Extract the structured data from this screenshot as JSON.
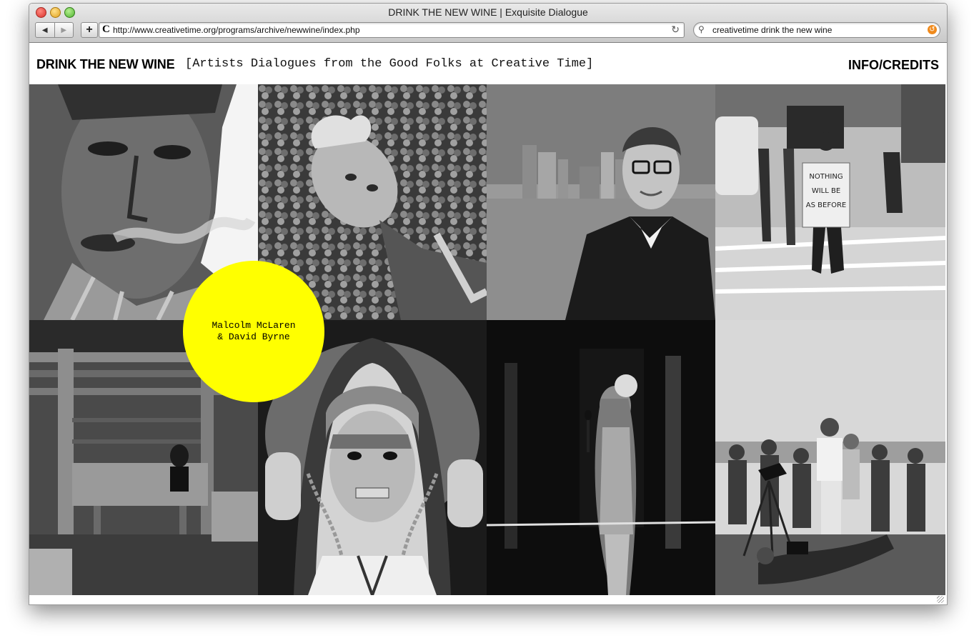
{
  "window": {
    "title": "DRINK THE NEW WINE | Exquisite Dialogue"
  },
  "toolbar": {
    "back_glyph": "◀",
    "forward_glyph": "▶",
    "add_glyph": "+",
    "url": "http://www.creativetime.org/programs/archive/newwine/index.php",
    "search_query": "creativetime drink the new wine",
    "favicon_glyph": "C"
  },
  "header": {
    "title": "DRINK THE NEW WINE",
    "subtitle": "[Artists Dialogues from the Good Folks at Creative Time]",
    "info_link": "INFO/CREDITS"
  },
  "hover_label": {
    "line1": "Malcolm McLaren",
    "line2": "& David Byrne"
  },
  "tiles": [
    {
      "icon": "portrait-smoking-man-photo"
    },
    {
      "icon": "man-lying-in-clover-photo"
    },
    {
      "icon": "man-glasses-waterfront-photo"
    },
    {
      "icon": "protester-sign-street-photo"
    },
    {
      "icon": "woman-in-wooden-barn-photo"
    },
    {
      "icon": "hooded-woman-grills-photo"
    },
    {
      "icon": "singer-with-microphone-photo"
    },
    {
      "icon": "crowd-with-cameras-photo"
    }
  ],
  "photo_texts": {
    "sign_line1": "NOTHING",
    "sign_line2": "WILL BE",
    "sign_line3": "AS BEFORE"
  },
  "colors": {
    "accent": "#ffff00",
    "text": "#000000"
  }
}
